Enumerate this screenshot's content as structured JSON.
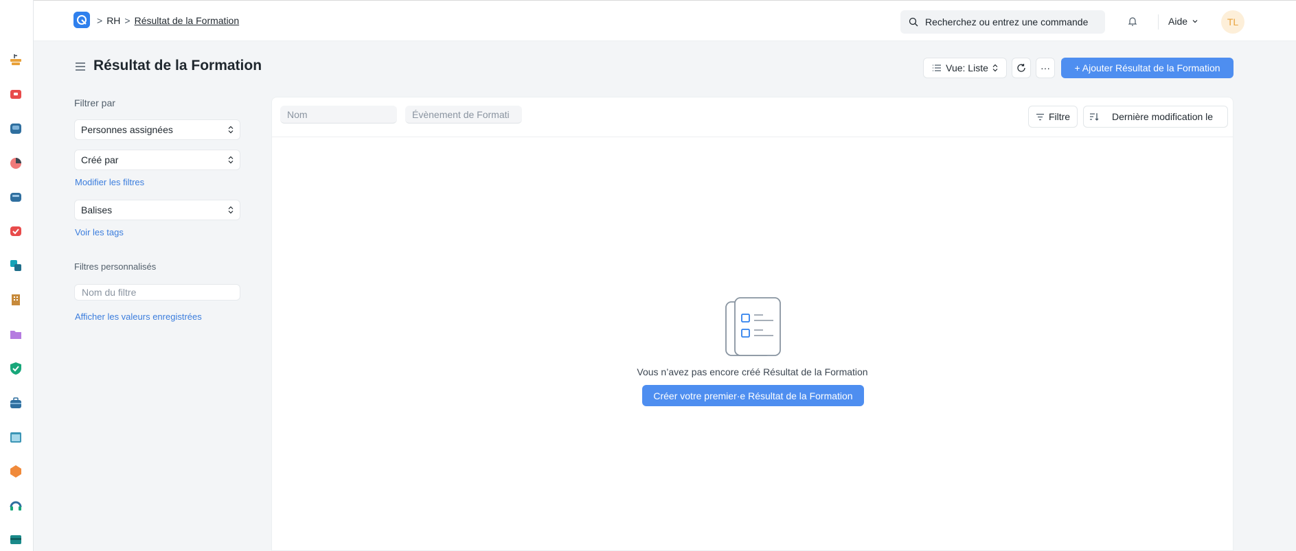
{
  "breadcrumb": {
    "separator": ">",
    "items": [
      "RH",
      "Résultat de la Formation"
    ]
  },
  "navbar": {
    "search_text": "Recherchez ou entrez une commande",
    "help_label": "Aide",
    "avatar_initials": "TL"
  },
  "page": {
    "title": "Résultat de la Formation",
    "view_label": "Vue: Liste",
    "more_label": "···",
    "add_label": "+ Ajouter Résultat de la Formation"
  },
  "filters": {
    "title": "Filtrer par",
    "assigned": "Personnes assignées",
    "created_by": "Créé par",
    "edit_filters": "Modifier les filtres",
    "tags": "Balises",
    "show_tags": "Voir les tags",
    "custom_title": "Filtres personnalisés",
    "filter_name_placeholder": "Nom du filtre",
    "show_saved": "Afficher les valeurs enregistrées"
  },
  "list": {
    "field_name_placeholder": "Nom",
    "field_event_placeholder": "Évènement de Formati",
    "filter_label": "Filtre",
    "sort_label": "Dernière modification le"
  },
  "empty": {
    "message": "Vous n’avez pas encore créé Résultat de la Formation",
    "cta": "Créer votre premier·e Résultat de la Formation"
  },
  "sidebar_apps": [
    "accounting-icon",
    "selling-icon",
    "buying-icon",
    "analytics-icon",
    "assets-icon",
    "quality-icon",
    "manufacturing-icon",
    "building-icon",
    "projects-icon",
    "support-icon",
    "hr-icon",
    "website-icon",
    "tools-icon",
    "helpdesk-icon",
    "payroll-icon"
  ],
  "colors": {
    "accent": "#4e8ef0",
    "link": "#3b7ddd"
  }
}
